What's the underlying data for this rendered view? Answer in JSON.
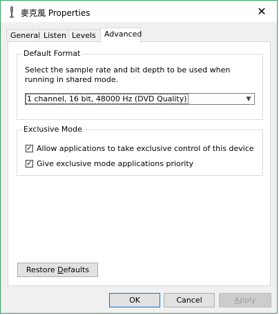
{
  "window": {
    "title": "麥克風 Properties",
    "close_label": "✕"
  },
  "tabs": [
    {
      "label": "General",
      "active": false
    },
    {
      "label": "Listen",
      "active": false
    },
    {
      "label": "Levels",
      "active": false
    },
    {
      "label": "Advanced",
      "active": true
    }
  ],
  "default_format": {
    "group_label": "Default Format",
    "description": "Select the sample rate and bit depth to be used when running in shared mode.",
    "selected_value": "1 channel, 16 bit, 48000 Hz (DVD Quality)"
  },
  "exclusive_mode": {
    "group_label": "Exclusive Mode",
    "options": [
      {
        "label": "Allow applications to take exclusive control of this device",
        "checked": true
      },
      {
        "label": "Give exclusive mode applications priority",
        "checked": true
      }
    ]
  },
  "buttons": {
    "restore_pre": "Restore ",
    "restore_key": "D",
    "restore_post": "efaults",
    "ok": "OK",
    "cancel": "Cancel",
    "apply_key": "A",
    "apply_post": "pply"
  },
  "icons": {
    "window_icon": "microphone-icon",
    "checkmark": "✓",
    "dropdown": "▼"
  }
}
